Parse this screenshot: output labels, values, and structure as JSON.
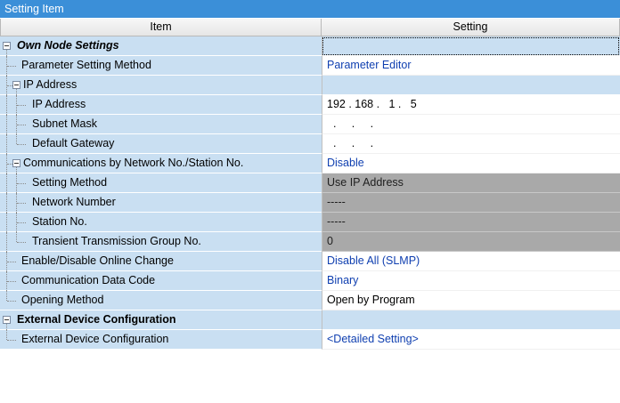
{
  "window": {
    "title": "Setting Item"
  },
  "header": {
    "item": "Item",
    "setting": "Setting"
  },
  "rows": [
    {
      "item": "Own Node Settings",
      "setting": ""
    },
    {
      "item": "Parameter Setting Method",
      "setting": "Parameter Editor"
    },
    {
      "item": "IP Address",
      "setting": ""
    },
    {
      "item": "IP Address",
      "setting": "192 . 168 .   1 .   5"
    },
    {
      "item": "Subnet Mask",
      "setting": "  .     .     ."
    },
    {
      "item": "Default Gateway",
      "setting": "  .     .     ."
    },
    {
      "item": "Communications by Network No./Station No.",
      "setting": "Disable"
    },
    {
      "item": "Setting Method",
      "setting": "Use IP Address"
    },
    {
      "item": "Network Number",
      "setting": "-----"
    },
    {
      "item": "Station No.",
      "setting": "-----"
    },
    {
      "item": "Transient Transmission Group No.",
      "setting": "0"
    },
    {
      "item": "Enable/Disable Online Change",
      "setting": "Disable All (SLMP)"
    },
    {
      "item": "Communication Data Code",
      "setting": "Binary"
    },
    {
      "item": "Opening Method",
      "setting": "Open by Program"
    },
    {
      "item": "External Device Configuration",
      "setting": ""
    },
    {
      "item": "External Device Configuration",
      "setting": "<Detailed Setting>"
    }
  ],
  "colors": {
    "title_bar": "#3b8fd8",
    "item_column": "#c9dff2",
    "link_text": "#0f3fb0",
    "disabled_cell": "#a9a9a9"
  },
  "icons": {
    "collapse": "minus-box-icon"
  }
}
